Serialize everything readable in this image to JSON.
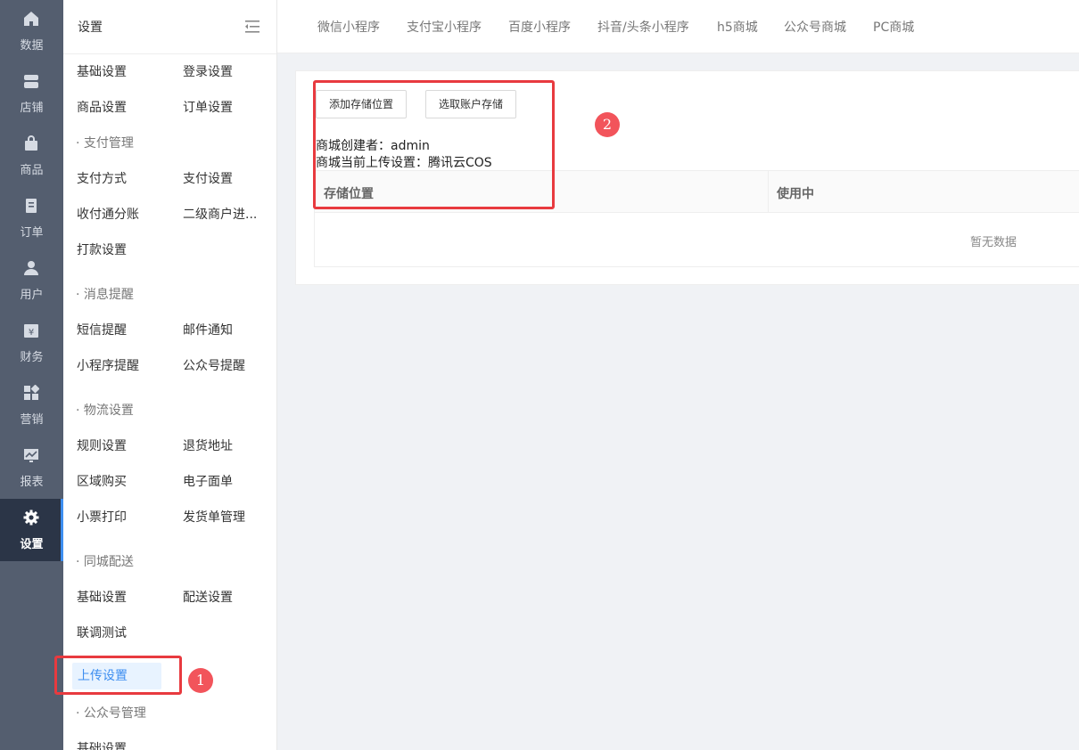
{
  "nav": {
    "items": [
      {
        "label": "数据",
        "icon": "home-icon"
      },
      {
        "label": "店铺",
        "icon": "store-icon"
      },
      {
        "label": "商品",
        "icon": "bag-icon"
      },
      {
        "label": "订单",
        "icon": "document-icon"
      },
      {
        "label": "用户",
        "icon": "user-icon"
      },
      {
        "label": "财务",
        "icon": "yen-icon"
      },
      {
        "label": "营销",
        "icon": "grid-icon"
      },
      {
        "label": "报表",
        "icon": "chart-icon"
      },
      {
        "label": "设置",
        "icon": "gear-icon",
        "active": true
      }
    ]
  },
  "submenu": {
    "title": "设置",
    "basic_settings": "基础设置",
    "login_settings": "登录设置",
    "product_settings": "商品设置",
    "order_settings": "订单设置",
    "group_payment": "· 支付管理",
    "payment_method": "支付方式",
    "payment_settings": "支付设置",
    "split_account": "收付通分账",
    "sub_merchant": "二级商户进...",
    "payout_settings": "打款设置",
    "group_message": "· 消息提醒",
    "sms_alert": "短信提醒",
    "email_notice": "邮件通知",
    "miniprogram_alert": "小程序提醒",
    "official_alert": "公众号提醒",
    "group_logistics": "· 物流设置",
    "rule_settings": "规则设置",
    "return_address": "退货地址",
    "regional_purchase": "区域购买",
    "e_waybill": "电子面单",
    "receipt_print": "小票打印",
    "shipping_manage": "发货单管理",
    "group_citydelivery": "· 同城配送",
    "city_basic": "基础设置",
    "delivery_settings": "配送设置",
    "joint_test": "联调测试",
    "upload_settings": "上传设置",
    "group_official": "· 公众号管理",
    "official_basic": "基础设置"
  },
  "tabs": [
    "微信小程序",
    "支付宝小程序",
    "百度小程序",
    "抖音/头条小程序",
    "h5商城",
    "公众号商城",
    "PC商城"
  ],
  "content": {
    "add_storage_button": "添加存储位置",
    "select_account_storage_button": "选取账户存储",
    "creator_line": "商城创建者：admin",
    "upload_setting_line": "商城当前上传设置：腾讯云COS",
    "table": {
      "columns": [
        "存储位置",
        "使用中"
      ],
      "empty_text": "暂无数据"
    }
  },
  "annotations": {
    "badge1": "1",
    "badge2": "2",
    "color": "#e83a3f"
  }
}
